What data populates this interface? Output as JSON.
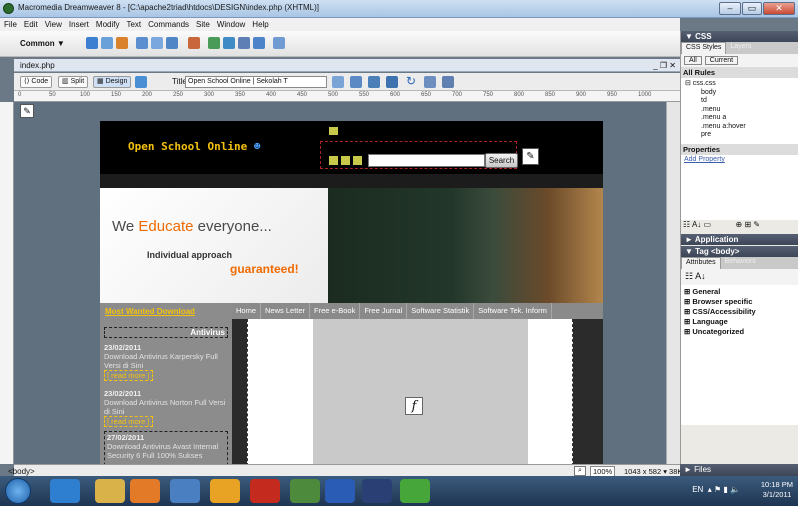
{
  "window": {
    "title": "Macromedia Dreamweaver 8 - [C:\\apache2triad\\htdocs\\DESIGN\\index.php (XHTML)]",
    "min": "–",
    "max": "▭",
    "close": "✕"
  },
  "menu": [
    "File",
    "Edit",
    "View",
    "Insert",
    "Modify",
    "Text",
    "Commands",
    "Site",
    "Window",
    "Help"
  ],
  "insertbar": {
    "category": "Common ▼"
  },
  "document": {
    "tab": "index.php",
    "tab_controls": "_ ❐ ✕",
    "views": {
      "code": "Code",
      "split": "Split",
      "design": "Design"
    },
    "title_label": "Title:",
    "title_value": "Open School Online | Sekolah T"
  },
  "ruler_marks": [
    "0",
    "50",
    "100",
    "150",
    "200",
    "250",
    "300",
    "350",
    "400",
    "450",
    "500",
    "550",
    "600",
    "650",
    "700",
    "750",
    "800",
    "850",
    "900",
    "950",
    "1000"
  ],
  "site": {
    "logo": "Open School Online",
    "search_button": "Search",
    "banner_we": "We ",
    "banner_educate": "Educate",
    "banner_everyone": " everyone...",
    "banner_sub": "Individual approach",
    "banner_guaranteed": "guaranteed!",
    "nav": [
      "Home",
      "News Letter",
      "Free e-Book",
      "Free Jurnal",
      "Software Statistik",
      "Software Tek. Inform"
    ],
    "side_title": "Most Wanted Download",
    "side_category": "Antivirus",
    "news": [
      {
        "date": "23/02/2011",
        "text": "Download Antivirus Karpersky Full Versi di Sini",
        "more": "[ read more ]"
      },
      {
        "date": "23/02/2011",
        "text": "Download Antivirus Norton Full Versi di Sini",
        "more": "[ read more ]"
      },
      {
        "date": "27/02/2011",
        "text": "Download Antivirus Avast Internal Security 6 Full 100% Sukses",
        "more": ""
      }
    ]
  },
  "status": {
    "tag": "<body>",
    "zoom": "100%",
    "info": "1043 x 582 ▾ 38K / 6 sec"
  },
  "panels": {
    "css_head": "▼ CSS",
    "css_tabs": [
      "CSS Styles",
      "Layers"
    ],
    "mode_tabs": [
      "All",
      "Current"
    ],
    "all_rules": "All Rules",
    "rules": [
      "⊟ css.css",
      "body",
      "td",
      ".menu",
      ".menu a",
      ".menu a:hover",
      "pre"
    ],
    "properties": "Properties",
    "add_property": "Add Property",
    "application": "► Application",
    "tag_head": "▼ Tag <body>",
    "tag_tabs": [
      "Attributes",
      "Behaviors"
    ],
    "categories": [
      "⊞ General",
      "⊞ Browser specific",
      "⊞ CSS/Accessibility",
      "⊞ Language",
      "⊞ Uncategorized"
    ],
    "files": "► Files"
  },
  "taskbar": {
    "lang": "EN",
    "time": "10:18 PM",
    "date": "3/1/2011"
  }
}
